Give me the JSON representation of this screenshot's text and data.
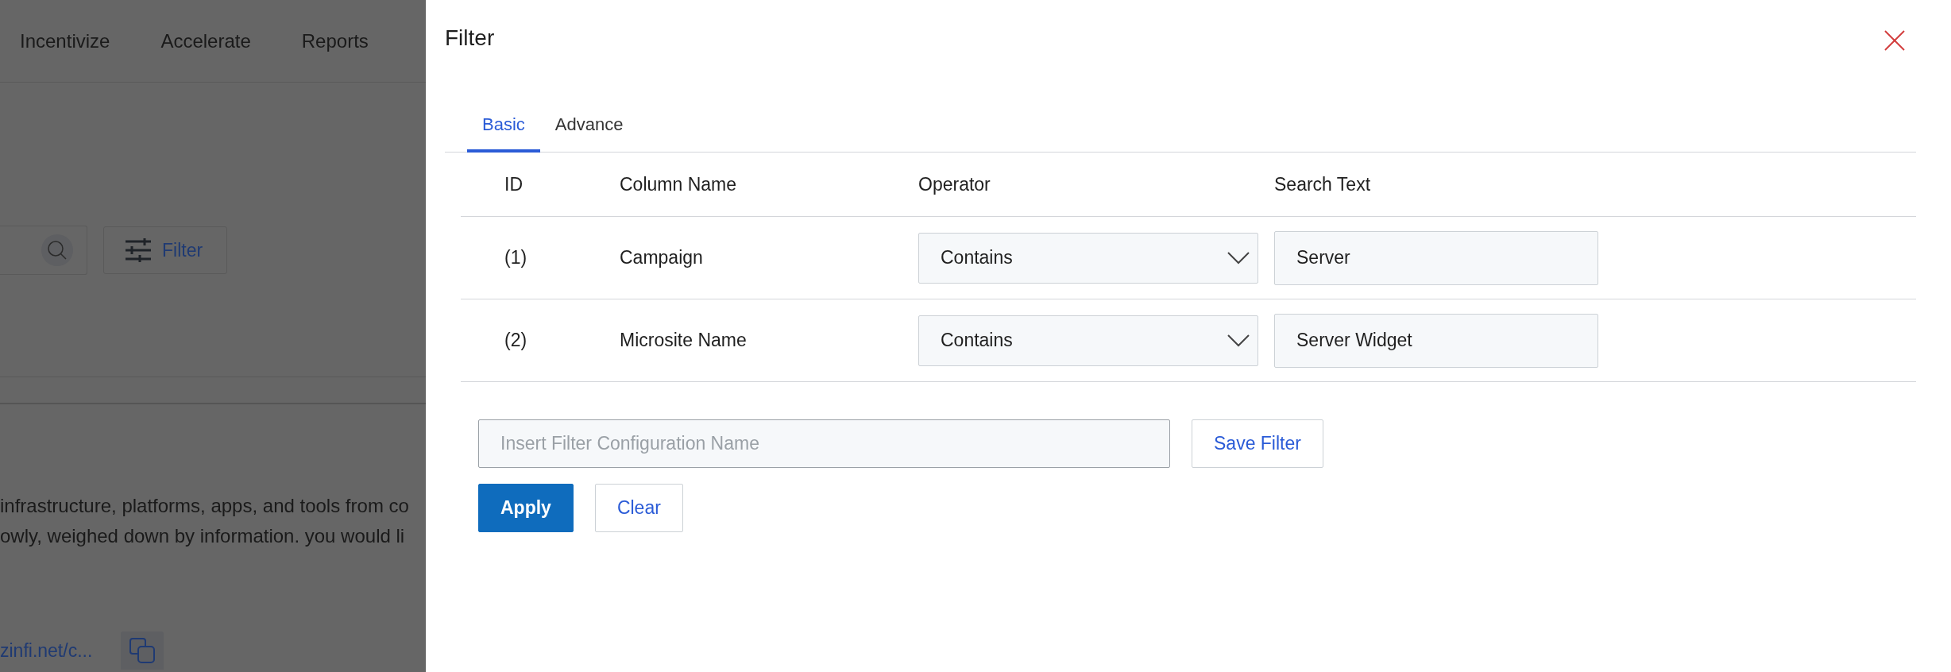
{
  "background_page": {
    "nav": [
      "Incentivize",
      "Accelerate",
      "Reports"
    ],
    "filter_button": "Filter",
    "description_lines": [
      "infrastructure, platforms, apps, and tools from co",
      "owly, weighed down by information. you would li"
    ],
    "link": "zinfi.net/c..."
  },
  "filter_panel": {
    "title": "Filter",
    "tabs": [
      {
        "label": "Basic",
        "selected": true
      },
      {
        "label": "Advance",
        "selected": false
      }
    ],
    "table": {
      "columns": [
        "ID",
        "Column Name",
        "Operator",
        "Search Text"
      ],
      "rows": [
        {
          "id": "(1)",
          "column_name": "Campaign",
          "operator": "Contains",
          "search_text": "Server"
        },
        {
          "id": "(2)",
          "column_name": "Microsite Name",
          "operator": "Contains",
          "search_text": "Server Widget"
        }
      ]
    },
    "config_name": {
      "placeholder": "Insert Filter Configuration Name"
    },
    "save_button": "Save Filter",
    "actions": [
      {
        "label": "Apply",
        "kind": "primary"
      },
      {
        "label": "Clear",
        "kind": "secondary"
      }
    ]
  }
}
